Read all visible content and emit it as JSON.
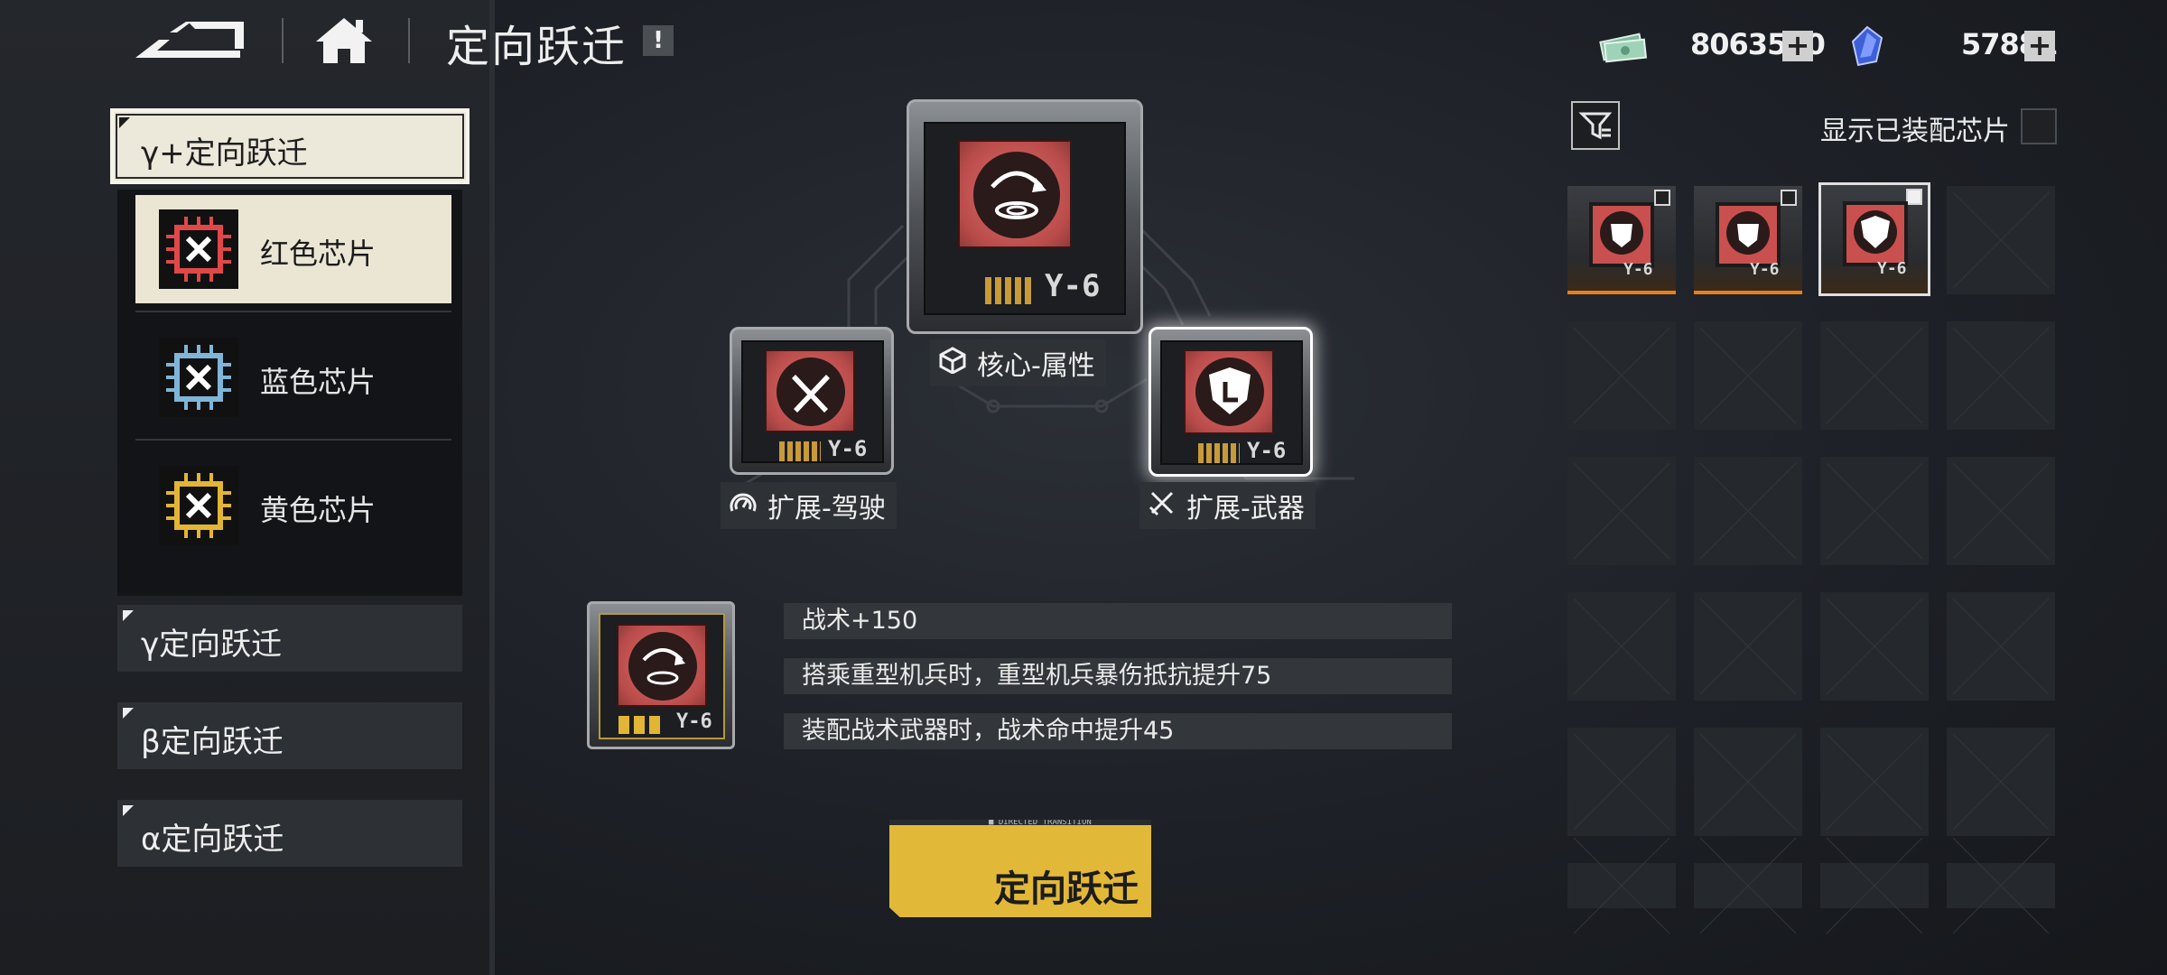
{
  "header": {
    "title": "定向跃迁",
    "info_symbol": "!",
    "back_icon": "back-arrow-icon",
    "home_icon": "home-icon"
  },
  "currency": {
    "gold": {
      "value": "8063510",
      "icon": "cash-stack-icon",
      "plus": "+"
    },
    "crystal": {
      "value": "57881",
      "icon": "blue-crystal-icon",
      "plus": "+"
    }
  },
  "sidebar": {
    "categories": [
      {
        "label": "γ+定向跃迁",
        "active": true
      },
      {
        "label": "γ定向跃迁",
        "active": false
      },
      {
        "label": "β定向跃迁",
        "active": false
      },
      {
        "label": "α定向跃迁",
        "active": false
      }
    ],
    "chips": [
      {
        "label": "红色芯片",
        "color": "#e04848",
        "selected": true
      },
      {
        "label": "蓝色芯片",
        "color": "#7fb6d8",
        "selected": false
      },
      {
        "label": "黄色芯片",
        "color": "#e3b534",
        "selected": false
      }
    ]
  },
  "nodes": {
    "core": {
      "label": "核心-属性",
      "tag": "Y-6",
      "icon": "cube-icon"
    },
    "left": {
      "label": "扩展-驾驶",
      "tag": "Y-6",
      "icon": "speedometer-icon"
    },
    "right": {
      "label": "扩展-武器",
      "tag": "Y-6",
      "icon": "crossed-swords-icon"
    }
  },
  "preview": {
    "tag": "Y-6",
    "attributes": [
      "战术+150",
      "搭乘重型机兵时，重型机兵暴伤抵抗提升75",
      "装配战术武器时，战术命中提升45"
    ]
  },
  "confirm": {
    "label": "定向跃迁",
    "sub": "■ DIRECTED TRANSITION"
  },
  "inventory": {
    "show_equipped_label": "显示已装配芯片",
    "filter_icon": "filter-icon",
    "items": [
      {
        "tag": "Y-6",
        "checked": false
      },
      {
        "tag": "Y-6",
        "checked": false
      },
      {
        "tag": "Y-6",
        "checked": true
      }
    ]
  },
  "colors": {
    "accent_yellow": "#e2b838",
    "chip_red": "#c9504e",
    "rarity_orange": "#e87f1e"
  }
}
